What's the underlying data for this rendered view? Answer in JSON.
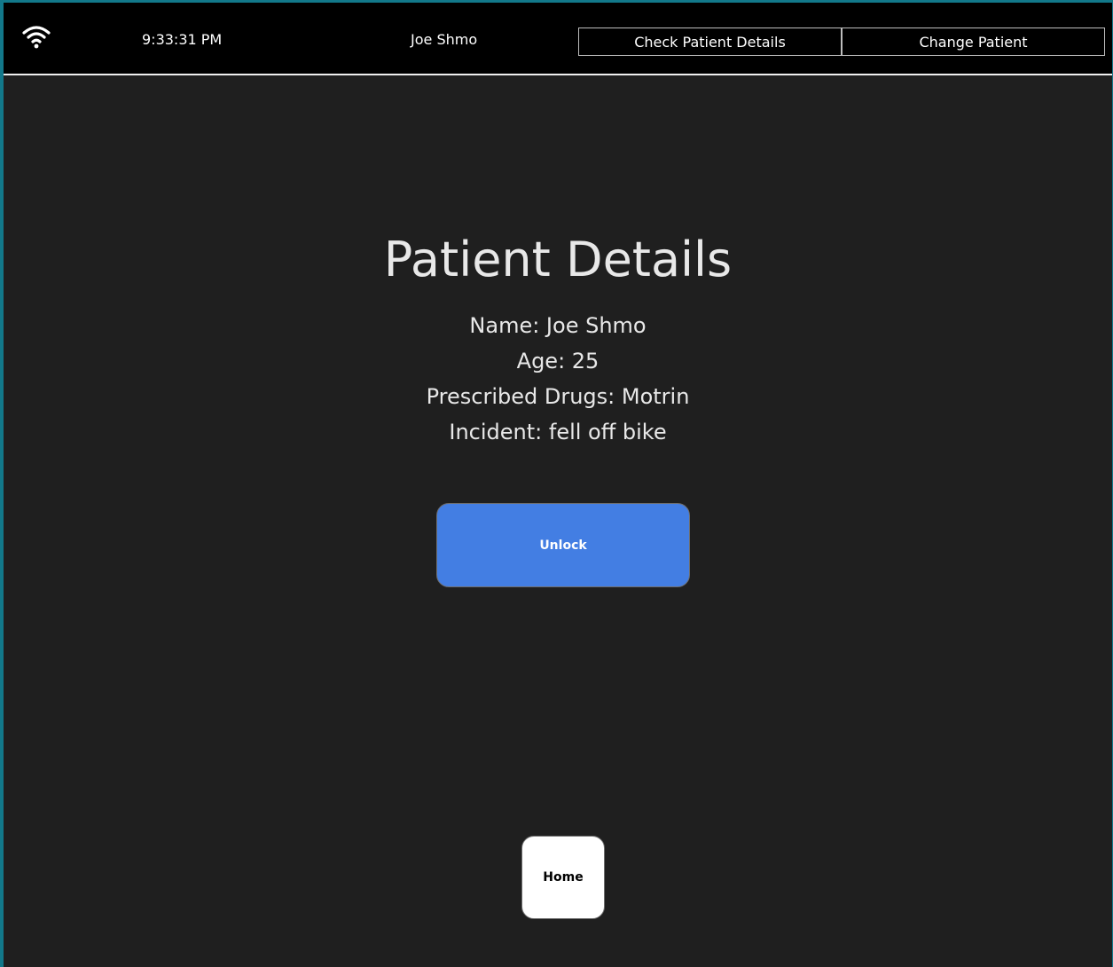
{
  "topbar": {
    "wifi_icon": "wifi-icon",
    "time": "9:33:31 PM",
    "patient_name": "Joe Shmo",
    "check_details_label": "Check Patient Details",
    "change_patient_label": "Change Patient"
  },
  "details": {
    "title": "Patient Details",
    "lines": [
      "Name: Joe Shmo",
      "Age: 25",
      "Prescribed Drugs: Motrin",
      "Incident: fell off bike"
    ]
  },
  "actions": {
    "unlock_label": "Unlock",
    "home_label": "Home"
  },
  "colors": {
    "accent_blue": "#437ee3",
    "window_border": "#12788a",
    "background": "#1f1f1f",
    "topbar": "#000000"
  }
}
